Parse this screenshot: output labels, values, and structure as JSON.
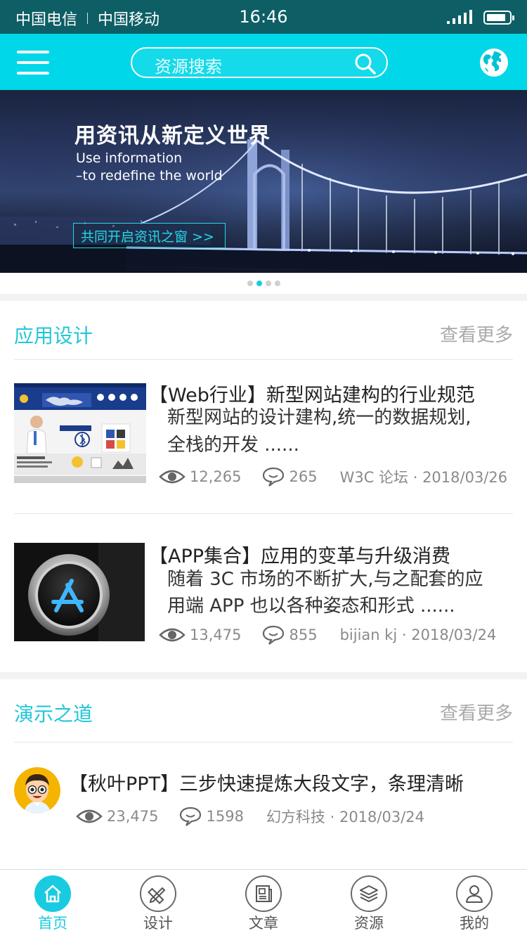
{
  "status_bar": {
    "carrier1": "中国电信",
    "carrier2": "中国移动",
    "time": "16:46"
  },
  "header": {
    "search_placeholder": "资源搜索",
    "menu_icon": "menu-icon",
    "search_icon": "search-icon",
    "globe_icon": "globe-icon"
  },
  "banner": {
    "title": "用资讯从新定义世界",
    "subtitle_line1": "Use information",
    "subtitle_line2": "–to redefine the world",
    "cta": "共同开启资讯之窗 >>",
    "dots_total": 4,
    "dots_active": 2
  },
  "sections": [
    {
      "title": "应用设计",
      "more": "查看更多",
      "articles": [
        {
          "title": "【Web行业】新型网站建构的行业规范",
          "desc_line1": "新型网站的设计建构,统一的数据规划,",
          "desc_line2": "全栈的开发 ......",
          "views": "12,265",
          "comments": "265",
          "source": "W3C 论坛 · 2018/03/26"
        },
        {
          "title": "【APP集合】应用的变革与升级消费",
          "desc_line1": "随着 3C 市场的不断扩大,与之配套的应",
          "desc_line2": "用端 APP 也以各种姿态和形式 ......",
          "views": "13,475",
          "comments": "855",
          "source": "bijian kj · 2018/03/24"
        }
      ]
    },
    {
      "title": "演示之道",
      "more": "查看更多",
      "articles": [
        {
          "title": "【秋叶PPT】三步快速提炼大段文字，条理清晰",
          "views": "23,475",
          "comments": "1598",
          "source": "幻方科技 · 2018/03/24"
        }
      ]
    }
  ],
  "tabbar": {
    "items": [
      {
        "label": "首页",
        "icon": "home-icon",
        "active": true
      },
      {
        "label": "设计",
        "icon": "pencil-ruler-icon",
        "active": false
      },
      {
        "label": "文章",
        "icon": "newspaper-icon",
        "active": false
      },
      {
        "label": "资源",
        "icon": "layers-icon",
        "active": false
      },
      {
        "label": "我的",
        "icon": "user-icon",
        "active": false
      }
    ]
  },
  "colors": {
    "accent": "#19cbe0",
    "header": "#00d7e8",
    "status_bar": "#0e5e66"
  }
}
